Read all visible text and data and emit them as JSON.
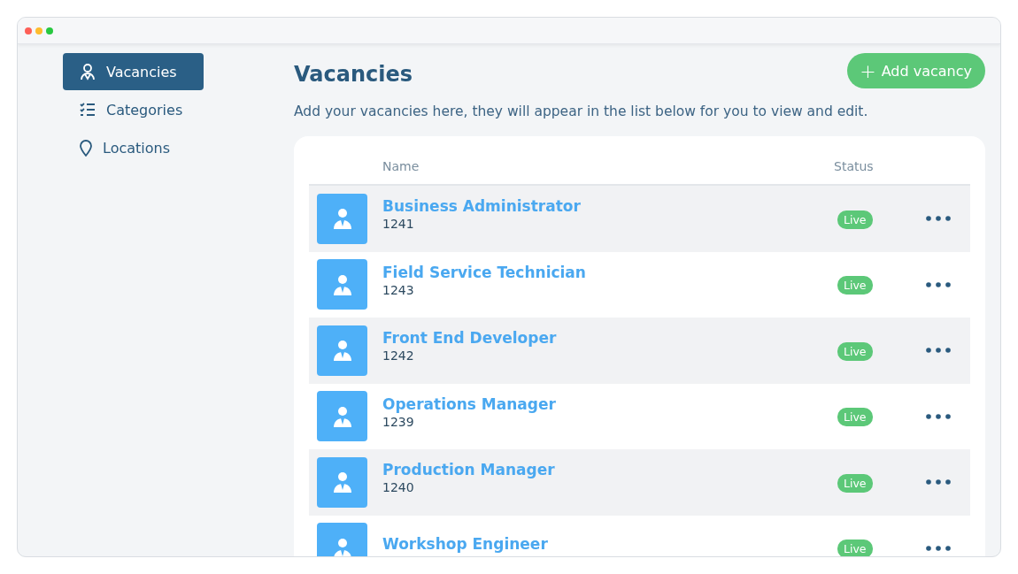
{
  "sidebar": {
    "items": [
      {
        "label": "Vacancies",
        "kind": "person",
        "selected": true
      },
      {
        "label": "Categories",
        "kind": "list",
        "selected": false
      },
      {
        "label": "Locations",
        "kind": "pin",
        "selected": false
      }
    ]
  },
  "page": {
    "title": "Vacancies",
    "subtitle": "Add your vacancies here, they will appear in the list below for you to view and edit.",
    "add_button": "+ Add vacancy"
  },
  "table": {
    "columns": [
      "Name",
      "Status"
    ],
    "rows": [
      {
        "name": "Business Administrator",
        "id": "1241",
        "status": "Live"
      },
      {
        "name": "Field Service Technician",
        "id": "1243",
        "status": "Live"
      },
      {
        "name": "Front End Developer",
        "id": "1242",
        "status": "Live"
      },
      {
        "name": "Operations Manager",
        "id": "1239",
        "status": "Live"
      },
      {
        "name": "Production Manager",
        "id": "1240",
        "status": "Live"
      },
      {
        "name": "Workshop Engineer",
        "status": "Live"
      }
    ]
  }
}
